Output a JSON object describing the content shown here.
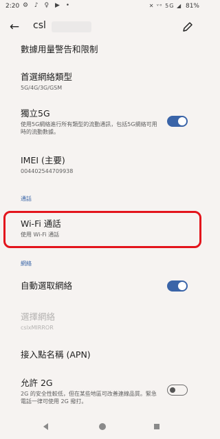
{
  "status_bar": {
    "time": "2:20",
    "notification_icons": "⚙ ♪ ♀ ▶ •",
    "signal_text": "✕ ᵛᵒ 5G ◢",
    "battery": "81%"
  },
  "app_bar": {
    "title": "csl"
  },
  "items": {
    "data_warning": {
      "title": "數據用量警告和限制"
    },
    "preferred_network": {
      "title": "首選網絡類型",
      "summary": "5G/4G/3G/GSM"
    },
    "standalone_5g": {
      "title": "獨立5G",
      "summary": "使用5G網絡進行所有類型的流動通訊，包括5G網絡可用時的流動數據。",
      "toggle_on": true
    },
    "imei": {
      "title": "IMEI (主要)",
      "summary": "004402544709938"
    },
    "wifi_calling": {
      "title": "Wi-Fi 通話",
      "summary": "使用 Wi-Fi 通話"
    },
    "auto_network": {
      "title": "自動選取網絡",
      "toggle_on": true
    },
    "choose_network": {
      "title": "選擇網絡",
      "summary": "cslxMIRROR"
    },
    "apn": {
      "title": "接入點名稱 (APN)"
    },
    "allow_2g": {
      "title": "允許 2G",
      "summary": "2G 的安全性較低，但在某些地區可改善連線品質。緊急電話一律可使用 2G 撥打。",
      "toggle_on": false
    }
  },
  "sections": {
    "calls": "通話",
    "network": "網絡"
  },
  "colors": {
    "accent": "#3a64a8",
    "highlight": "#e3141c",
    "background": "#f6f3f1"
  }
}
